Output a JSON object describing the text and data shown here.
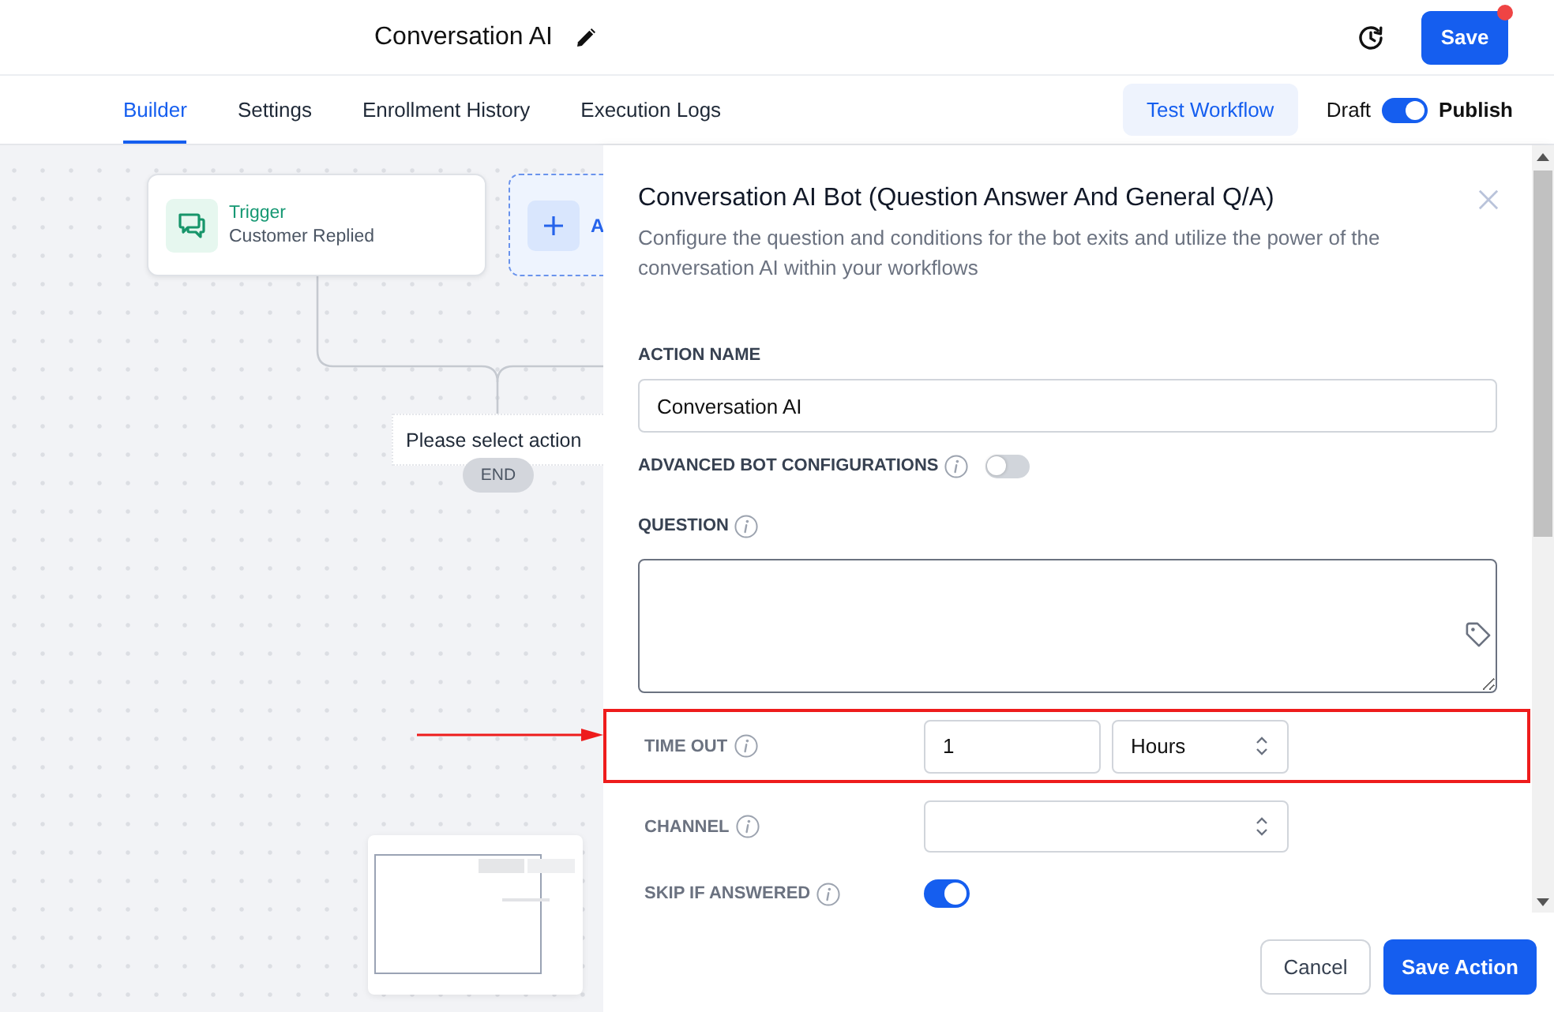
{
  "header": {
    "title": "Conversation AI",
    "save_button": "Save",
    "save_badge": true
  },
  "tabs": [
    {
      "label": "Builder",
      "selected": true
    },
    {
      "label": "Settings",
      "selected": false
    },
    {
      "label": "Enrollment History",
      "selected": false
    },
    {
      "label": "Execution Logs",
      "selected": false
    }
  ],
  "toolbar": {
    "test_button": "Test Workflow",
    "publish_toggle": {
      "off_label": "Draft",
      "on_label": "Publish",
      "on": true
    }
  },
  "canvas": {
    "trigger": {
      "title": "Trigger",
      "subtitle": "Customer Replied"
    },
    "add_node": {
      "label": "A"
    },
    "tooltip": "Please select action",
    "end_label": "END"
  },
  "panel": {
    "title": "Conversation AI Bot (Question Answer And General Q/A)",
    "description": "Configure the question and conditions for the bot exits and utilize the power of the conversation AI within your workflows",
    "fields": [
      {
        "kind": "text",
        "label": "ACTION NAME",
        "info": false,
        "value": "Conversation AI"
      },
      {
        "kind": "toggle",
        "label": "ADVANCED BOT CONFIGURATIONS",
        "info": true,
        "on": false
      },
      {
        "kind": "textarea",
        "label": "QUESTION",
        "info": true
      }
    ],
    "settings": [
      {
        "kind": "number-unit",
        "label": "TIME OUT",
        "info": true,
        "value": "1",
        "unit": "Hours",
        "highlighted": true
      },
      {
        "kind": "select",
        "label": "CHANNEL",
        "info": true,
        "highlighted": false
      },
      {
        "kind": "toggle",
        "label": "SKIP IF ANSWERED",
        "info": true,
        "on": true,
        "highlighted": false
      }
    ],
    "buttons": {
      "cancel": "Cancel",
      "save": "Save Action"
    }
  }
}
